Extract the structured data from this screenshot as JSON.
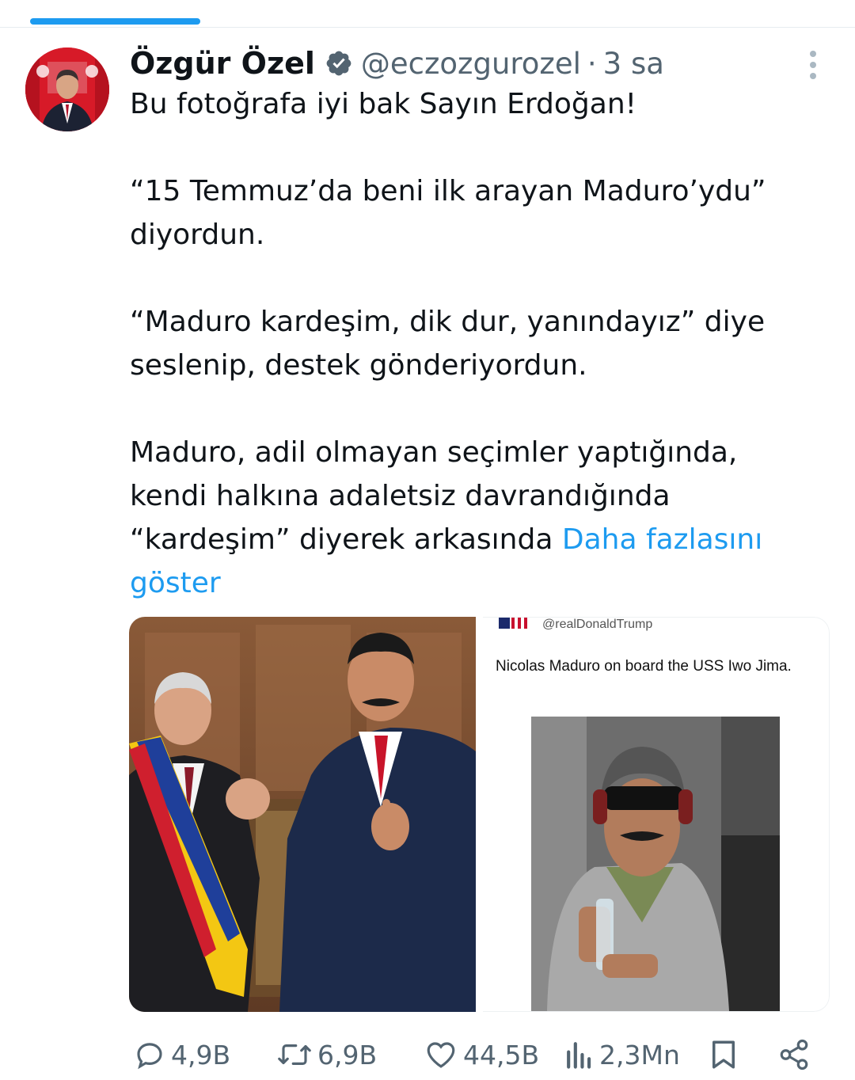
{
  "tweet": {
    "author": {
      "display_name": "Özgür Özel",
      "handle": "@eczozgurozel",
      "verified": true,
      "avatar_icon": "avatar-photo"
    },
    "separator": "·",
    "timestamp": "3 sa",
    "text": {
      "line1": "Bu fotoğrafa iyi bak Sayın Erdoğan!",
      "para2_line1": "“15 Temmuz’da beni ilk arayan Maduro’ydu”",
      "para2_line2": "diyordun.",
      "para3_line1": "“Maduro kardeşim, dik dur, yanındayız” diye",
      "para3_line2": "seslenip, destek gönderiyordun.",
      "para4_line1": "Maduro, adil olmayan seçimler yaptığında,",
      "para4_line2": "kendi halkına adaletsiz davrandığında",
      "para4_line3": "“kardeşim” diyerek arkasında ",
      "show_more": "Daha fazlasını",
      "show_more_2": "göster"
    },
    "media": {
      "left_photo": "photo-erdogan-maduro",
      "right_embed": {
        "handle": "@realDonaldTrump",
        "text": "Nicolas Maduro on board the USS Iwo Jima."
      }
    },
    "actions": {
      "replies": "4,9B",
      "retweets": "6,9B",
      "likes": "44,5B",
      "views": "2,3Mn"
    }
  },
  "colors": {
    "accent": "#1d9bf0",
    "text": "#0f1419",
    "secondary": "#536471"
  }
}
